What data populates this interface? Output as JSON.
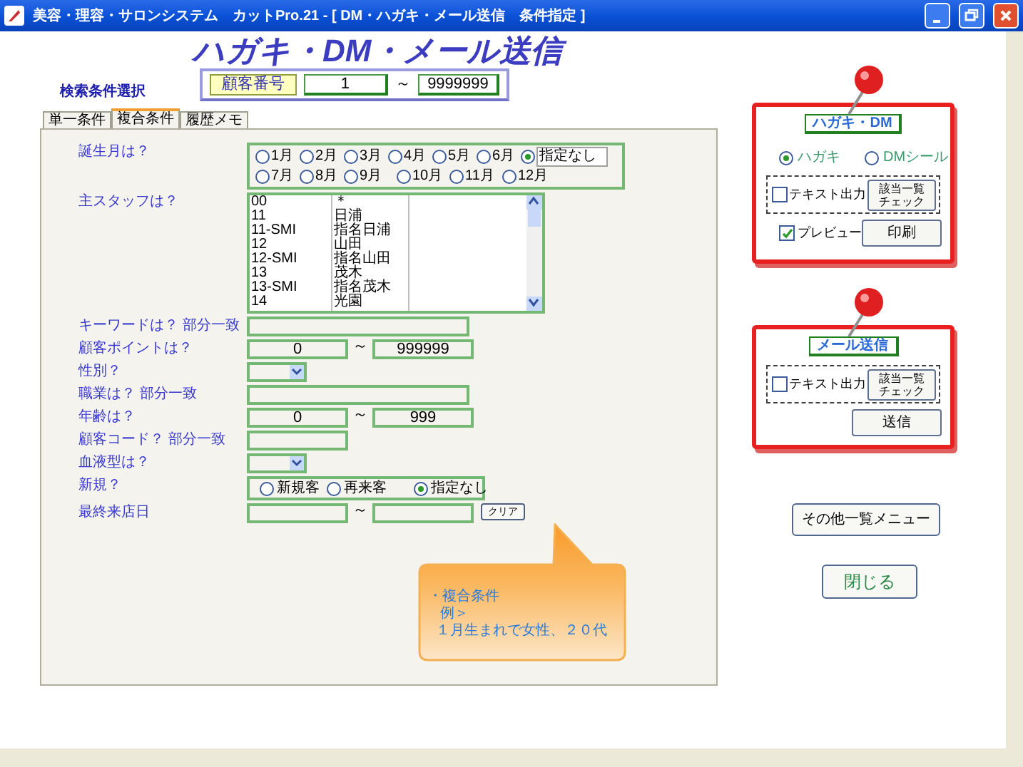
{
  "window": {
    "title": "美容・理容・サロンシステム　カットPro.21 - [ DM・ハガキ・メール送信　条件指定 ]"
  },
  "header": {
    "title": "ハガキ・DM・メール送信",
    "search_section_label": "検索条件選択"
  },
  "customer_number": {
    "label": "顧客番号",
    "from": "1",
    "separator": "～",
    "to": "9999999"
  },
  "tabs": [
    {
      "label": "単一条件",
      "selected": false
    },
    {
      "label": "複合条件",
      "selected": true
    },
    {
      "label": "履歴メモ",
      "selected": false
    }
  ],
  "form": [
    {
      "kind": "radio_grid",
      "label": "誕生月は？",
      "options": [
        {
          "label": "1月",
          "selected": false
        },
        {
          "label": "2月",
          "selected": false
        },
        {
          "label": "3月",
          "selected": false
        },
        {
          "label": "4月",
          "selected": false
        },
        {
          "label": "5月",
          "selected": false
        },
        {
          "label": "6月",
          "selected": false
        },
        {
          "label": "指定なし",
          "selected": true
        },
        {
          "label": "7月",
          "selected": false
        },
        {
          "label": "8月",
          "selected": false
        },
        {
          "label": "9月",
          "selected": false
        },
        {
          "label": "10月",
          "selected": false
        },
        {
          "label": "11月",
          "selected": false
        },
        {
          "label": "12月",
          "selected": false
        }
      ]
    },
    {
      "kind": "list",
      "label": "主スタッフは？",
      "items": [
        {
          "code": "00",
          "name": "＊"
        },
        {
          "code": "11",
          "name": "日浦"
        },
        {
          "code": "11-SMI",
          "name": "指名日浦"
        },
        {
          "code": "12",
          "name": "山田"
        },
        {
          "code": "12-SMI",
          "name": "指名山田"
        },
        {
          "code": "13",
          "name": "茂木"
        },
        {
          "code": "13-SMI",
          "name": "指名茂木"
        },
        {
          "code": "14",
          "name": "光園"
        }
      ]
    },
    {
      "kind": "text",
      "label": "キーワードは？ 部分一致"
    },
    {
      "kind": "range",
      "label": "顧客ポイントは？",
      "from": "0",
      "separator": "～",
      "to": "999999"
    },
    {
      "kind": "select",
      "label": "性別？"
    },
    {
      "kind": "text",
      "label": "職業は？ 部分一致"
    },
    {
      "kind": "range",
      "label": "年齢は？",
      "from": "0",
      "separator": "～",
      "to": "999"
    },
    {
      "kind": "short_text",
      "label": "顧客コード？ 部分一致"
    },
    {
      "kind": "select",
      "label": "血液型は？"
    },
    {
      "kind": "radio",
      "label": "新規？",
      "options": [
        {
          "label": "新規客",
          "selected": false
        },
        {
          "label": "再来客",
          "selected": false
        },
        {
          "label": "指定なし",
          "selected": true
        }
      ]
    },
    {
      "kind": "date_range",
      "label": "最終来店日",
      "separator": "～",
      "button": "クリア"
    }
  ],
  "callout": {
    "lines": [
      "・複合条件",
      "例＞",
      "１月生まれで女性、２０代"
    ]
  },
  "cards": [
    {
      "title": "ハガキ・DM",
      "radios": [
        {
          "label": "ハガキ",
          "selected": true
        },
        {
          "label": "DMシール",
          "selected": false
        }
      ],
      "text_output": {
        "label": "テキスト出力",
        "checked": false
      },
      "check_button_lines": [
        "該当一覧",
        "チェック"
      ],
      "preview": {
        "label": "プレビュー",
        "checked": true
      },
      "action_button": "印刷"
    },
    {
      "title": "メール送信",
      "text_output": {
        "label": "テキスト出力",
        "checked": false
      },
      "check_button_lines": [
        "該当一覧",
        "チェック"
      ],
      "action_button": "送信"
    }
  ],
  "buttons": [
    {
      "label": "その他一覧メニュー",
      "kind": "plain"
    },
    {
      "label": "閉じる",
      "kind": "green"
    }
  ]
}
